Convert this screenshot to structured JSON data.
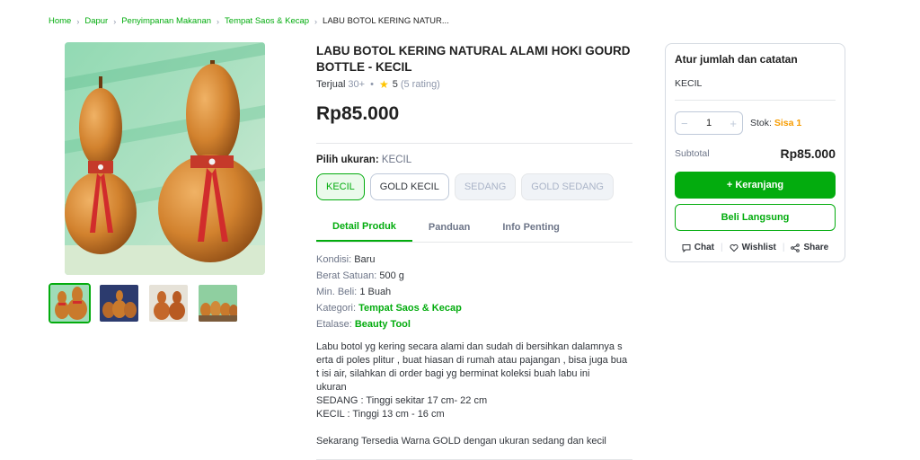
{
  "breadcrumb": {
    "items": [
      "Home",
      "Dapur",
      "Penyimpanan Makanan",
      "Tempat Saos & Kecap"
    ],
    "current": "LABU BOTOL KERING NATUR..."
  },
  "gallery": {
    "thumbnail_count": 4,
    "active_index": 0
  },
  "product": {
    "title": "LABU BOTOL KERING NATURAL ALAMI HOKI GOURD BOTTLE - KECIL",
    "sold_label": "Terjual",
    "sold_count": "30+",
    "rating": "5",
    "rating_count": "(5 rating)",
    "price": "Rp85.000",
    "variant_label": "Pilih ukuran:",
    "variant_selected": "KECIL",
    "variants": [
      {
        "label": "KECIL",
        "state": "selected"
      },
      {
        "label": "GOLD KECIL",
        "state": "available"
      },
      {
        "label": "SEDANG",
        "state": "disabled"
      },
      {
        "label": "GOLD SEDANG",
        "state": "disabled"
      }
    ]
  },
  "tabs": [
    "Detail Produk",
    "Panduan",
    "Info Penting"
  ],
  "specs": {
    "kondisi_label": "Kondisi:",
    "kondisi": "Baru",
    "berat_label": "Berat Satuan:",
    "berat": "500 g",
    "min_label": "Min. Beli:",
    "min": "1 Buah",
    "kategori_label": "Kategori:",
    "kategori": "Tempat Saos & Kecap",
    "etalase_label": "Etalase:",
    "etalase": "Beauty Tool"
  },
  "description": "Labu botol yg kering secara alami dan sudah di bersihkan dalamnya s\nerta di poles plitur , buat hiasan di rumah atau pajangan , bisa juga bua\nt isi air, silahkan di order bagi yg berminat koleksi buah labu ini\nukuran\nSEDANG :  Tinggi sekitar 17 cm- 22 cm\nKECIL : Tinggi 13 cm - 16 cm\n\nSekarang Tersedia Warna GOLD dengan ukuran sedang dan kecil",
  "card": {
    "title": "Atur jumlah dan catatan",
    "variant": "KECIL",
    "qty": "1",
    "minus": "−",
    "plus": "+",
    "stock_label": "Stok:",
    "stock_value": "Sisa 1",
    "subtotal_label": "Subtotal",
    "subtotal_value": "Rp85.000",
    "cart_button": "+ Keranjang",
    "buy_button": "Beli Langsung",
    "chat": "Chat",
    "wishlist": "Wishlist",
    "share": "Share"
  },
  "colors": {
    "primary": "#03ac0e",
    "warning": "#f79c00",
    "star": "#ffc400"
  }
}
